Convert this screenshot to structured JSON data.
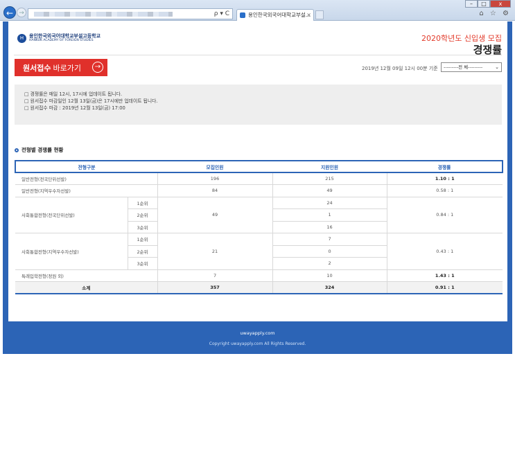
{
  "browser": {
    "tab_title": "용인한국외국어대학교부설...",
    "tab_close": "×",
    "back_glyph": "←",
    "fwd_glyph": "→",
    "addr_icons": "ρ ▾ C",
    "win_min": "–",
    "win_max": "□",
    "win_close": "x",
    "right_icons": "⌂ ☆ ⚙"
  },
  "header": {
    "logo_mark": "H",
    "logo_ko": "용인한국외국어대학교부설고등학교",
    "logo_en": "HANKUK ACADEMY OF FOREIGN STUDIES",
    "title_small": "2020학년도 신입생 모집",
    "title_big": "경쟁률"
  },
  "apply": {
    "label_strong": "원서접수",
    "label_rest": "바로가기",
    "arrow": "→"
  },
  "basis": "2019년 12월 09일 12시 00분 기준",
  "select": {
    "value": "---------전 체---------",
    "caret": "⌄"
  },
  "notices": [
    "□ 경쟁률은 매일 12시, 17시에 업데이트 됩니다.",
    "□ 원서접수 마감일인 12월 13일(금)은 17시에만 업데이트 됩니다.",
    "□ 원서접수 마감 : 2019년 12월 13일(금) 17:00"
  ],
  "section_title": "전형별 경쟁률 현황",
  "table": {
    "headers": [
      "전형구분",
      "모집인원",
      "지원인원",
      "경쟁률"
    ],
    "r1": {
      "type": "일반전형(전국단위선발)",
      "quota": "196",
      "applicants": "215",
      "rate": "1.10 : 1"
    },
    "r2": {
      "type": "일반전형(지역우수자선발)",
      "quota": "84",
      "applicants": "49",
      "rate": "0.58 : 1"
    },
    "g1": {
      "type": "사회통합전형(전국단위선발)",
      "quota": "49",
      "rate": "0.84 : 1",
      "ranks": [
        "1순위",
        "2순위",
        "3순위"
      ],
      "applicants": [
        "24",
        "1",
        "16"
      ]
    },
    "g2": {
      "type": "사회통합전형(지역우수자선발)",
      "quota": "21",
      "rate": "0.43 : 1",
      "ranks": [
        "1순위",
        "2순위",
        "3순위"
      ],
      "applicants": [
        "7",
        "0",
        "2"
      ]
    },
    "r3": {
      "type": "특례입학전형(정원 외)",
      "quota": "7",
      "applicants": "10",
      "rate": "1.43 : 1"
    },
    "total": {
      "label": "소계",
      "quota": "357",
      "applicants": "324",
      "rate": "0.91 : 1"
    }
  },
  "footer": {
    "site": "uwayapply.com",
    "copy": "Copyright uwayapply.com All Rights Reserved."
  }
}
